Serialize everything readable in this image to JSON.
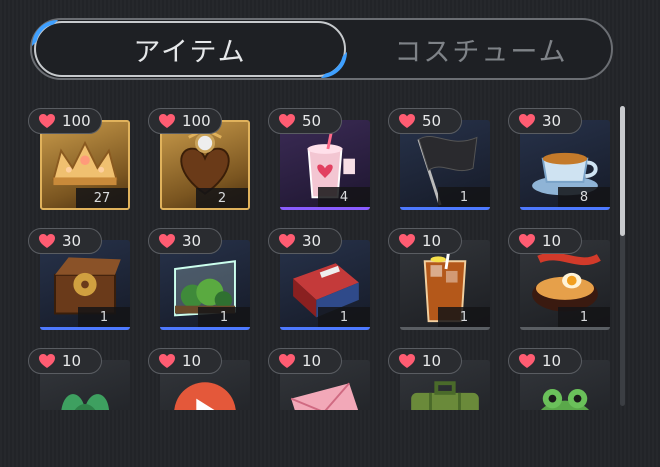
{
  "tabs": [
    {
      "label": "アイテム",
      "active": true
    },
    {
      "label": "コスチューム",
      "active": false
    }
  ],
  "colors": {
    "accent": "#3fa0ff",
    "heart": "#ff5c72",
    "gold": "#e0b25c",
    "purple": "#8a5cff",
    "blue": "#4d79ff"
  },
  "items": [
    {
      "name": "tiara-item",
      "likes": "100",
      "quantity": "27",
      "rarity": "gold",
      "icon": "tiara-icon"
    },
    {
      "name": "chocolate-heart-item",
      "likes": "100",
      "quantity": "2",
      "rarity": "gold",
      "icon": "chocolate-icon"
    },
    {
      "name": "strawberry-drink-item",
      "likes": "50",
      "quantity": "4",
      "rarity": "purple",
      "icon": "drink-cup-icon"
    },
    {
      "name": "black-flag-item",
      "likes": "50",
      "quantity": "1",
      "rarity": "blue",
      "icon": "flag-icon"
    },
    {
      "name": "teacup-item",
      "likes": "30",
      "quantity": "8",
      "rarity": "blue",
      "icon": "teacup-icon"
    },
    {
      "name": "music-box-item",
      "likes": "30",
      "quantity": "1",
      "rarity": "blue",
      "icon": "music-box-icon"
    },
    {
      "name": "terrarium-item",
      "likes": "30",
      "quantity": "1",
      "rarity": "blue",
      "icon": "terrarium-icon"
    },
    {
      "name": "book-box-item",
      "likes": "30",
      "quantity": "1",
      "rarity": "blue",
      "icon": "book-icon"
    },
    {
      "name": "iced-tea-item",
      "likes": "10",
      "quantity": "1",
      "rarity": "gray",
      "icon": "iced-drink-icon"
    },
    {
      "name": "ramen-item",
      "likes": "10",
      "quantity": "1",
      "rarity": "gray",
      "icon": "ramen-icon"
    },
    {
      "name": "leaf-item",
      "likes": "10",
      "quantity": "",
      "rarity": "gray",
      "icon": "leaf-icon"
    },
    {
      "name": "play-button-item",
      "likes": "10",
      "quantity": "",
      "rarity": "gray",
      "icon": "play-icon"
    },
    {
      "name": "pink-envelope-item",
      "likes": "10",
      "quantity": "",
      "rarity": "gray",
      "icon": "envelope-icon"
    },
    {
      "name": "green-suitcase-item",
      "likes": "10",
      "quantity": "",
      "rarity": "gray",
      "icon": "suitcase-icon"
    },
    {
      "name": "frog-item",
      "likes": "10",
      "quantity": "",
      "rarity": "gray",
      "icon": "frog-icon"
    }
  ]
}
